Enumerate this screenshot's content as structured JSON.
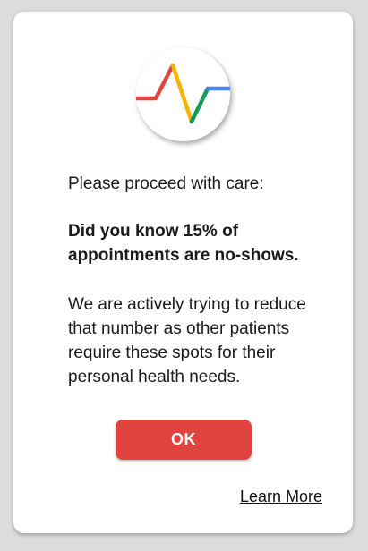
{
  "dialog": {
    "intro": "Please proceed with care:",
    "highlight": "Did you know 15% of appointments are no-shows.",
    "body": "We are actively trying to reduce that number as other patients require these spots for their personal health needs.",
    "ok_label": "OK",
    "learn_more_label": "Learn More"
  },
  "logo": {
    "icon": "heartbeat-pulse-icon",
    "colors": [
      "#e0443e",
      "#f4b400",
      "#0f9d58",
      "#4285f4"
    ]
  },
  "colors": {
    "accent": "#e0443e",
    "background": "#dcdcdc",
    "card": "#ffffff"
  }
}
